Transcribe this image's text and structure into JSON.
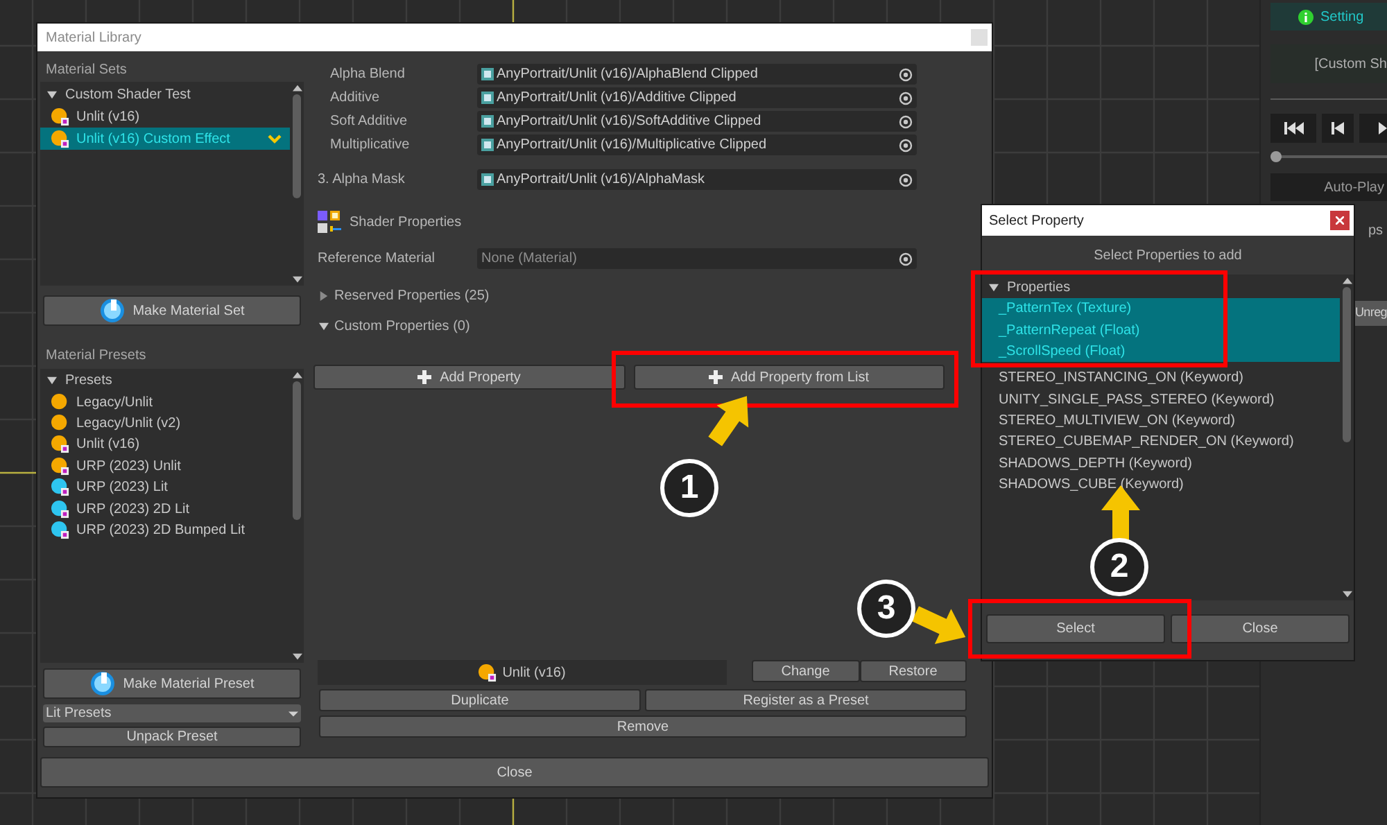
{
  "window": {
    "title": "Material Library"
  },
  "material_sets": {
    "label": "Material Sets",
    "tree": [
      {
        "label": "Custom Shader Test",
        "expanded": true,
        "children": [
          {
            "label": "Unlit (v16)",
            "kind": "unlit",
            "selected": false
          },
          {
            "label": "Unlit (v16) Custom Effect",
            "kind": "unlit",
            "selected": true
          }
        ]
      }
    ],
    "button": "Make Material Set"
  },
  "material_presets": {
    "label": "Material Presets",
    "tree": [
      {
        "label": "Presets",
        "expanded": true,
        "children": [
          {
            "label": "Legacy/Unlit",
            "kind": "legacy",
            "selected": false
          },
          {
            "label": "Legacy/Unlit (v2)",
            "kind": "legacy",
            "selected": false
          },
          {
            "label": "Unlit (v16)",
            "kind": "unlit",
            "selected": false
          },
          {
            "label": "URP (2023) Unlit",
            "kind": "unlit",
            "selected": false
          },
          {
            "label": "URP (2023) Lit",
            "kind": "lit",
            "selected": false
          },
          {
            "label": "URP (2023) 2D Lit",
            "kind": "lit",
            "selected": false
          },
          {
            "label": "URP (2023) 2D Bumped Lit",
            "kind": "lit",
            "selected": false
          }
        ]
      }
    ],
    "button": "Make Material Preset",
    "dropdown": "Lit Presets",
    "unpack_button": "Unpack Preset"
  },
  "shaders": [
    {
      "label": "Alpha Blend",
      "value": "AnyPortrait/Unlit (v16)/AlphaBlend Clipped",
      "kind": "sub"
    },
    {
      "label": "Additive",
      "value": "AnyPortrait/Unlit (v16)/Additive Clipped",
      "kind": "sub"
    },
    {
      "label": "Soft Additive",
      "value": "AnyPortrait/Unlit (v16)/SoftAdditive Clipped",
      "kind": "sub"
    },
    {
      "label": "Multiplicative",
      "value": "AnyPortrait/Unlit (v16)/Multiplicative Clipped",
      "kind": "sub"
    },
    {
      "label": "3. Alpha Mask",
      "value": "AnyPortrait/Unlit (v16)/AlphaMask",
      "kind": "main"
    }
  ],
  "shader_properties": {
    "title": "Shader Properties",
    "reference_label": "Reference Material",
    "reference_value": "None (Material)",
    "sections": [
      {
        "label": "Reserved Properties (25)",
        "expanded": false
      },
      {
        "label": "Custom Properties (0)",
        "expanded": true
      }
    ],
    "buttons": [
      "Add Property",
      "Add Property from List"
    ]
  },
  "current_material": {
    "label": "Unlit (v16)",
    "kind": "unlit"
  },
  "actions": [
    "Change",
    "Restore",
    "Duplicate",
    "Register as a Preset",
    "Remove"
  ],
  "close_button": "Close",
  "dialog": {
    "title": "Select Property",
    "header": "Select Properties to add",
    "tree": [
      {
        "label": "Properties",
        "expanded": true,
        "children": [
          {
            "label": "_PatternTex (Texture)",
            "selected": true
          },
          {
            "label": "_PatternRepeat (Float)",
            "selected": true
          },
          {
            "label": "_ScrollSpeed (Float)",
            "selected": true
          },
          {
            "label": "STEREO_INSTANCING_ON (Keyword)",
            "selected": false
          },
          {
            "label": "UNITY_SINGLE_PASS_STEREO (Keyword)",
            "selected": false
          },
          {
            "label": "STEREO_MULTIVIEW_ON (Keyword)",
            "selected": false
          },
          {
            "label": "STEREO_CUBEMAP_RENDER_ON (Keyword)",
            "selected": false
          },
          {
            "label": "SHADOWS_DEPTH (Keyword)",
            "selected": false
          },
          {
            "label": "SHADOWS_CUBE (Keyword)",
            "selected": false
          }
        ]
      }
    ],
    "buttons": [
      "Select",
      "Close"
    ]
  },
  "side_panel": {
    "tab": "Setting",
    "title": "[Custom Sh",
    "timeline": {
      "level": 0
    },
    "autoplay": "Auto-Play",
    "label": "ps",
    "button": "Unreg"
  },
  "annotations": [
    {
      "number": "1"
    },
    {
      "number": "2"
    },
    {
      "number": "3"
    }
  ]
}
